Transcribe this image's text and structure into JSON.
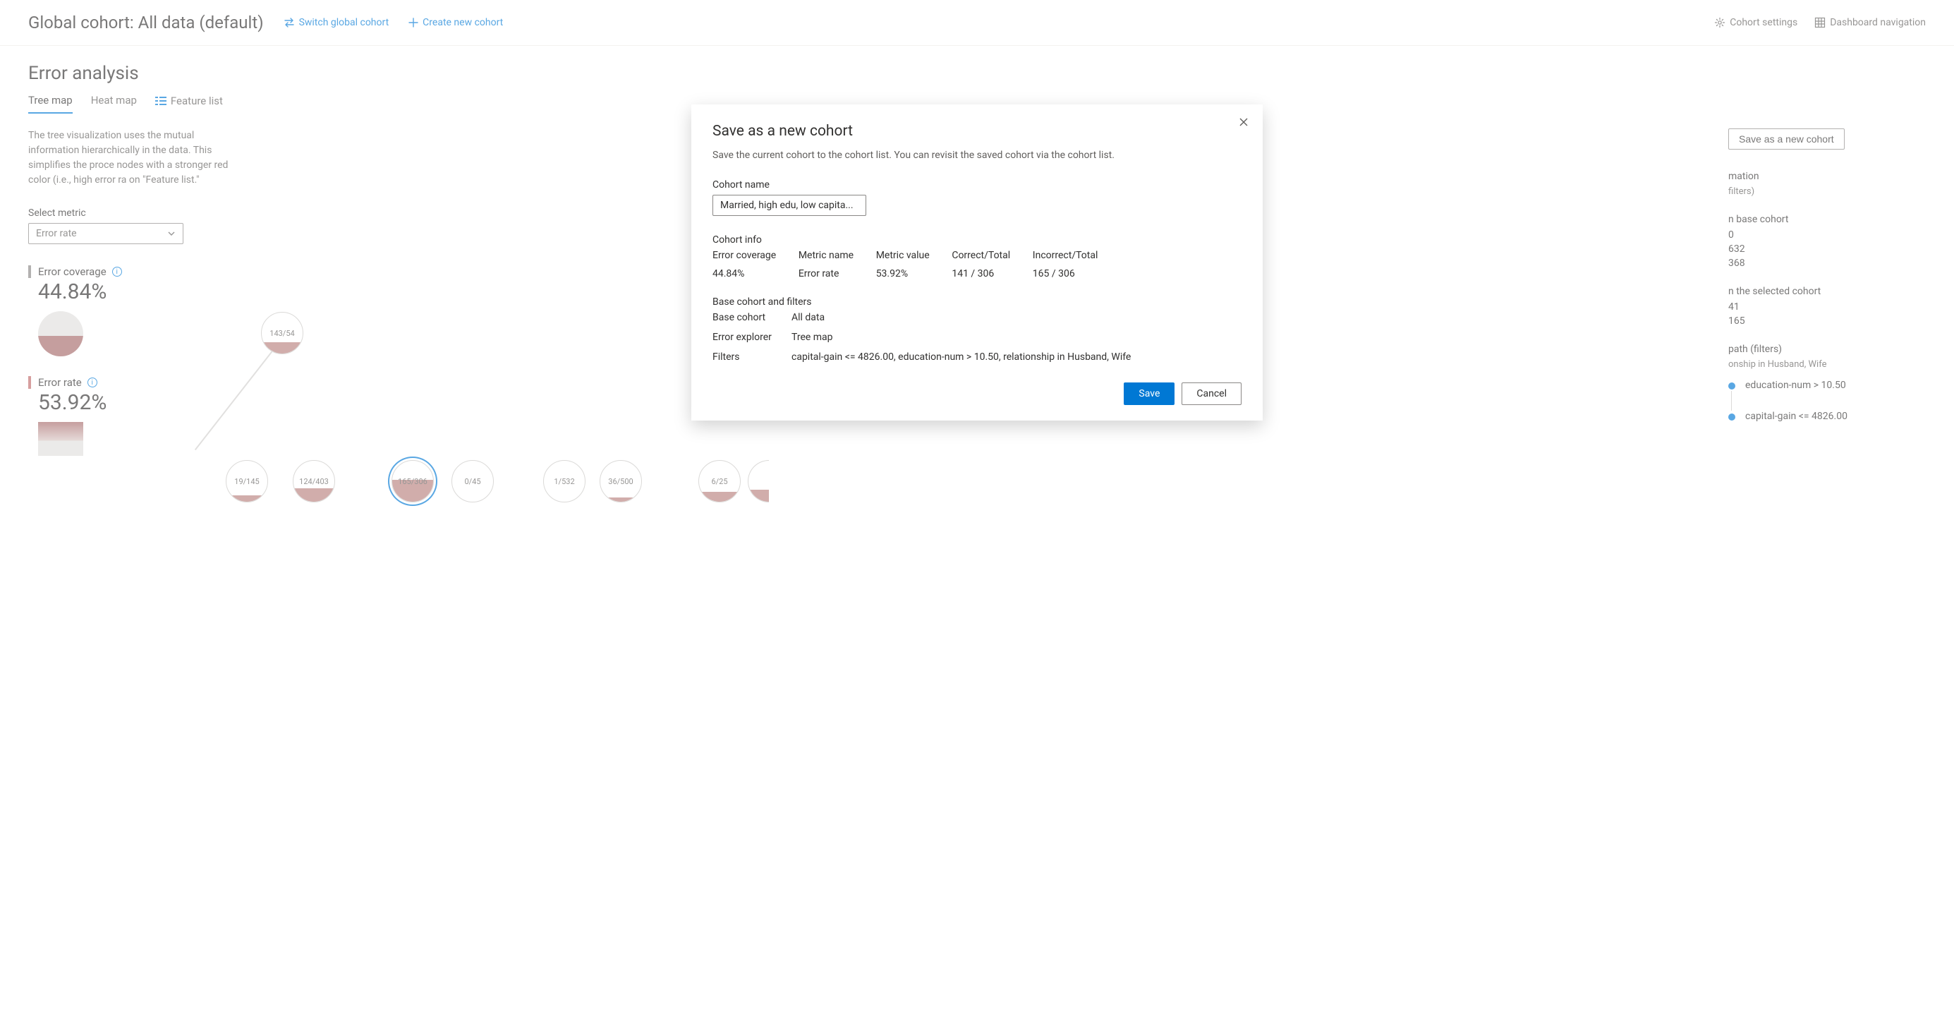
{
  "header": {
    "title": "Global cohort: All data (default)",
    "switch_label": "Switch global cohort",
    "create_label": "Create new cohort",
    "settings_label": "Cohort settings",
    "nav_label": "Dashboard navigation"
  },
  "page": {
    "title": "Error analysis",
    "tabs": {
      "tree": "Tree map",
      "heat": "Heat map",
      "feature": "Feature list"
    },
    "tree_desc": "The tree visualization uses the mutual information hierarchically in the data. This simplifies the proce nodes with a stronger red color (i.e., high error ra on \"Feature list.\"",
    "metric_label": "Select metric",
    "metric_value": "Error rate",
    "coverage_label": "Error coverage",
    "coverage_value": "44.84%",
    "rate_label": "Error rate",
    "rate_value": "53.92%"
  },
  "tree": {
    "root": "143/54",
    "n1": "19/145",
    "n2": "124/403",
    "n3": "165/306",
    "n4": "0/45",
    "n5": "1/532",
    "n6": "36/500",
    "n7": "6/25"
  },
  "rightpanel": {
    "save_btn": "Save as a new cohort",
    "info_title": "mation",
    "filters_stub": "filters)",
    "base_heading": "n base cohort",
    "v0": "0",
    "v632": "632",
    "v368": "368",
    "sel_heading": "n the selected cohort",
    "v41": "41",
    "v165": "165",
    "path_heading": "path (filters)",
    "p1": "onship in Husband, Wife",
    "p2": "education-num > 10.50",
    "p3": "capital-gain <= 4826.00"
  },
  "modal": {
    "title": "Save as a new cohort",
    "desc": "Save the current cohort to the cohort list. You can revisit the saved cohort via the cohort list.",
    "name_label": "Cohort name",
    "name_value": "Married, high edu, low capita...",
    "info_label": "Cohort info",
    "cols": {
      "coverage": "Error coverage",
      "metric_name": "Metric name",
      "metric_value": "Metric value",
      "correct": "Correct/Total",
      "incorrect": "Incorrect/Total"
    },
    "vals": {
      "coverage": "44.84%",
      "metric_name": "Error rate",
      "metric_value": "53.92%",
      "correct": "141 / 306",
      "incorrect": "165 / 306"
    },
    "base_label": "Base cohort and filters",
    "kv": {
      "base_k": "Base cohort",
      "base_v": "All data",
      "explorer_k": "Error explorer",
      "explorer_v": "Tree map",
      "filters_k": "Filters",
      "filters_v": "capital-gain <= 4826.00, education-num > 10.50, relationship in Husband, Wife"
    },
    "save": "Save",
    "cancel": "Cancel"
  }
}
